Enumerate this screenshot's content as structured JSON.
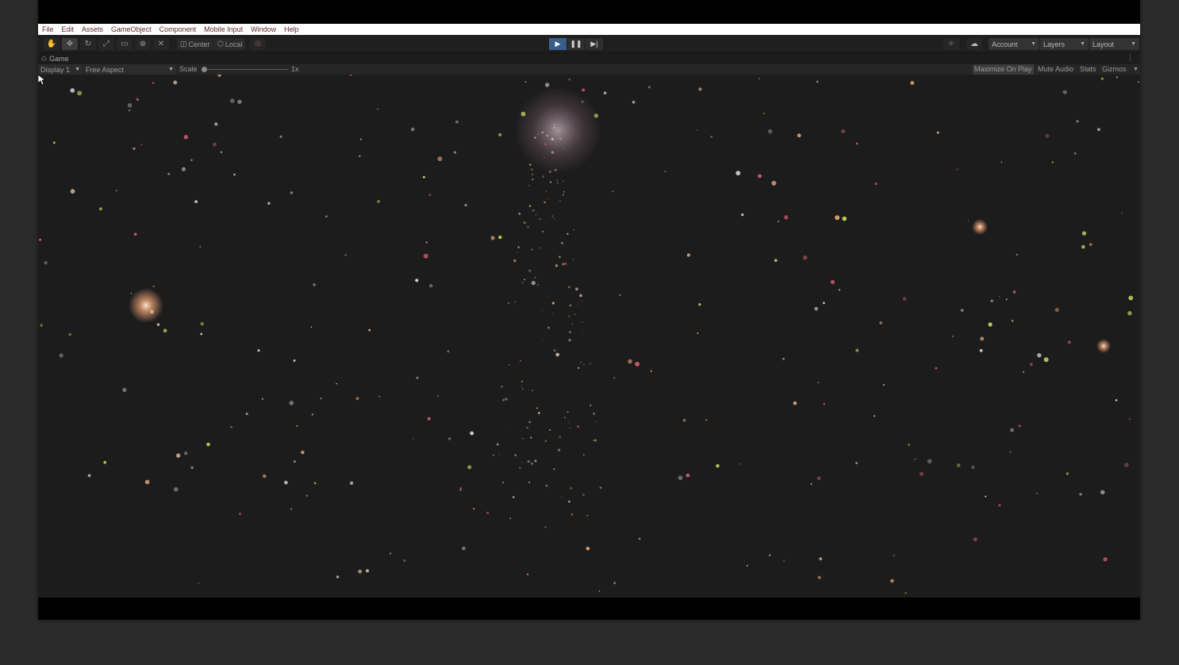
{
  "menubar": {
    "items": [
      "File",
      "Edit",
      "Assets",
      "GameObject",
      "Component",
      "Mobile Input",
      "Window",
      "Help"
    ]
  },
  "toolbar": {
    "tools": [
      {
        "name": "hand-tool-button",
        "icon": "hand-icon",
        "glyph": "✋",
        "active": false
      },
      {
        "name": "move-tool-button",
        "icon": "move-icon",
        "glyph": "✥",
        "active": true
      },
      {
        "name": "rotate-tool-button",
        "icon": "rotate-icon",
        "glyph": "↻",
        "active": false
      },
      {
        "name": "scale-tool-button",
        "icon": "scale-icon",
        "glyph": "⤢",
        "active": false
      },
      {
        "name": "rect-tool-button",
        "icon": "rect-icon",
        "glyph": "▭",
        "active": false
      },
      {
        "name": "transform-tool-button",
        "icon": "transform-icon",
        "glyph": "⊕",
        "active": false
      },
      {
        "name": "custom-tool-button",
        "icon": "tools-icon",
        "glyph": "✕",
        "active": false
      }
    ],
    "pivot_label": "Center",
    "space_label": "Local",
    "account_label": "Account",
    "layers_label": "Layers",
    "layout_label": "Layout",
    "playmode": {
      "playing": true
    }
  },
  "game_tab": {
    "label": "Game"
  },
  "game_bar": {
    "display_label": "Display 1",
    "aspect_label": "Free Aspect",
    "scale_label": "Scale",
    "scale_value_label": "1x",
    "maximize_label": "Maximize On Play",
    "mute_label": "Mute Audio",
    "stats_label": "Stats",
    "gizmos_label": "Gizmos",
    "maximize_on": true
  },
  "scene": {
    "background": "#1c1c1c",
    "accent_play": "#3a5d8a",
    "particle_colors": [
      "#e8c9b0",
      "#c9d1c9",
      "#d89a6a",
      "#b8cf5a",
      "#c85a6a",
      "#a0a0a0"
    ]
  }
}
